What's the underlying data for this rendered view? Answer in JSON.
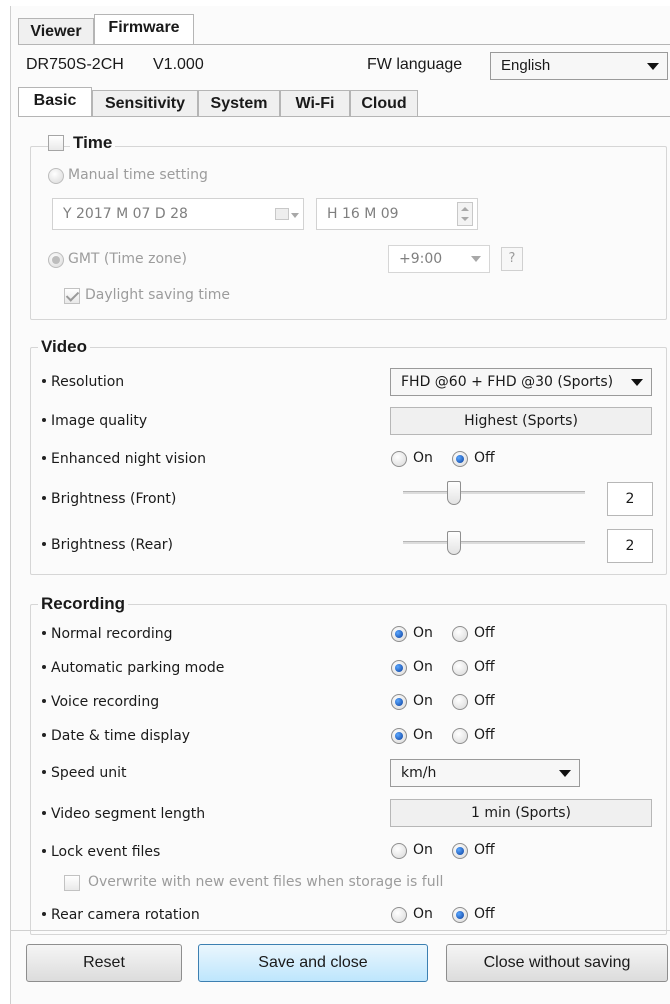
{
  "top_tabs": [
    {
      "label": "Viewer"
    },
    {
      "label": "Firmware"
    }
  ],
  "header": {
    "model": "DR750S-2CH",
    "version": "V1.000",
    "fw_language_label": "FW language",
    "fw_language_value": "English"
  },
  "sub_tabs": [
    {
      "label": "Basic"
    },
    {
      "label": "Sensitivity"
    },
    {
      "label": "System"
    },
    {
      "label": "Wi-Fi"
    },
    {
      "label": "Cloud"
    }
  ],
  "time": {
    "title": "Time",
    "manual_label": "Manual time setting",
    "date_value": "Y 2017 M 07 D 28",
    "time_value": "H 16 M 09",
    "gmt_label": "GMT (Time zone)",
    "gmt_value": "+9:00",
    "help_label": "?",
    "dst_label": "Daylight saving time"
  },
  "video": {
    "title": "Video",
    "resolution_label": "Resolution",
    "resolution_value": "FHD @60 + FHD @30 (Sports)",
    "image_quality_label": "Image quality",
    "image_quality_value": "Highest (Sports)",
    "night_vision_label": "Enhanced night vision",
    "brightness_front_label": "Brightness (Front)",
    "brightness_front_value": "2",
    "brightness_rear_label": "Brightness (Rear)",
    "brightness_rear_value": "2"
  },
  "recording": {
    "title": "Recording",
    "normal_label": "Normal recording",
    "parking_label": "Automatic parking mode",
    "voice_label": "Voice recording",
    "datetime_label": "Date & time display",
    "speed_unit_label": "Speed unit",
    "speed_unit_value": "km/h",
    "segment_label": "Video segment length",
    "segment_value": "1 min (Sports)",
    "lock_label": "Lock event files",
    "overwrite_label": "Overwrite with new event files when storage is full",
    "rear_rotation_label": "Rear camera rotation"
  },
  "radio": {
    "on": "On",
    "off": "Off"
  },
  "buttons": {
    "reset": "Reset",
    "save_close": "Save and close",
    "close_no_save": "Close without saving"
  }
}
